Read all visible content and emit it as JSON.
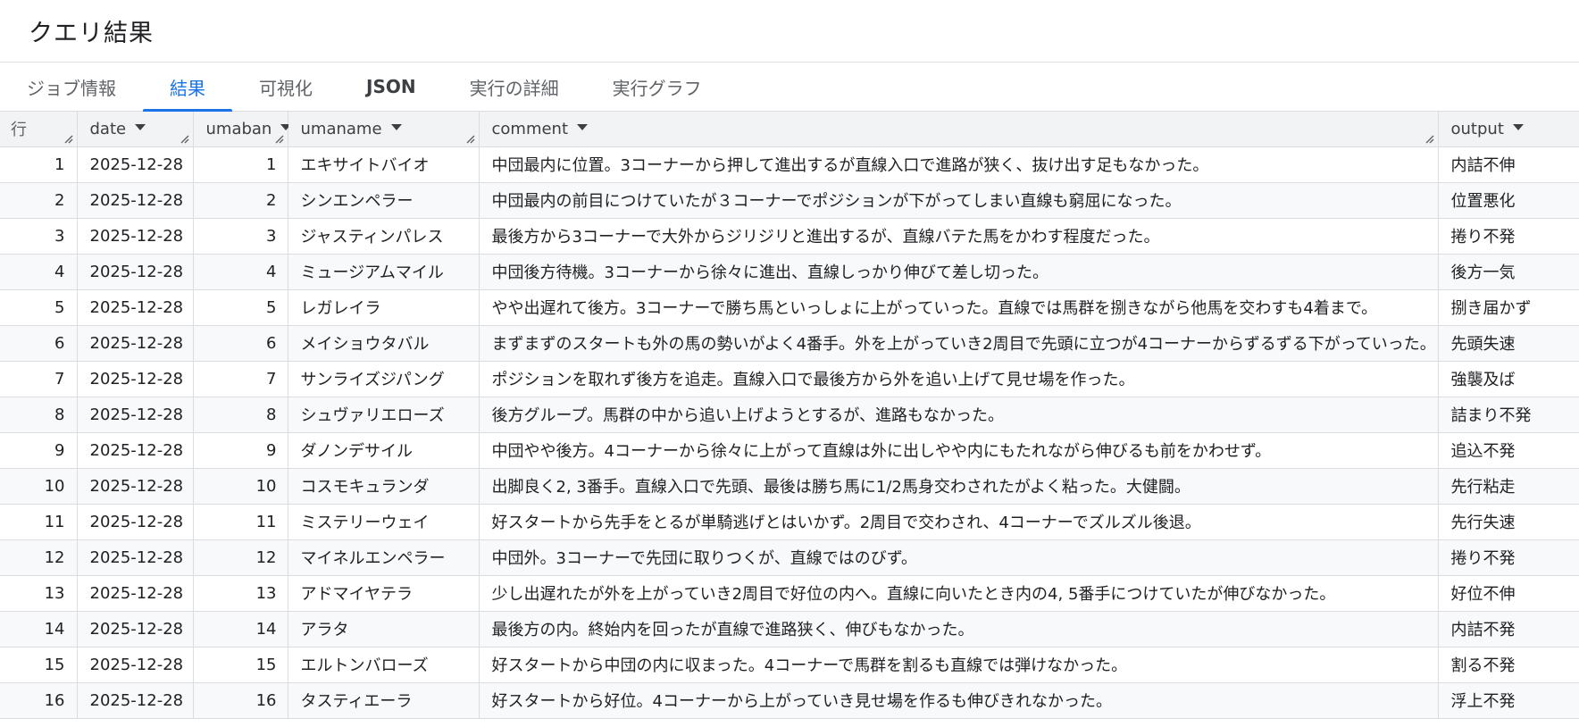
{
  "page_title": "クエリ結果",
  "tabs": [
    {
      "label": "ジョブ情報"
    },
    {
      "label": "結果"
    },
    {
      "label": "可視化"
    },
    {
      "label": "JSON"
    },
    {
      "label": "実行の詳細"
    },
    {
      "label": "実行グラフ"
    }
  ],
  "active_tab": "結果",
  "columns": {
    "row": "行",
    "date": "date",
    "umaban": "umaban",
    "umaname": "umaname",
    "comment": "comment",
    "output": "output"
  },
  "rows": [
    {
      "row": "1",
      "date": "2025-12-28",
      "umaban": "1",
      "umaname": "エキサイトバイオ",
      "comment": "中団最内に位置。3コーナーから押して進出するが直線入口で進路が狭く、抜け出す足もなかった。",
      "output": "内詰不伸"
    },
    {
      "row": "2",
      "date": "2025-12-28",
      "umaban": "2",
      "umaname": "シンエンペラー",
      "comment": "中団最内の前目につけていたが３コーナーでポジションが下がってしまい直線も窮屈になった。",
      "output": "位置悪化"
    },
    {
      "row": "3",
      "date": "2025-12-28",
      "umaban": "3",
      "umaname": "ジャスティンパレス",
      "comment": "最後方から3コーナーで大外からジリジリと進出するが、直線バテた馬をかわす程度だった。",
      "output": "捲り不発"
    },
    {
      "row": "4",
      "date": "2025-12-28",
      "umaban": "4",
      "umaname": "ミュージアムマイル",
      "comment": "中団後方待機。3コーナーから徐々に進出、直線しっかり伸びて差し切った。",
      "output": "後方一気"
    },
    {
      "row": "5",
      "date": "2025-12-28",
      "umaban": "5",
      "umaname": "レガレイラ",
      "comment": "やや出遅れて後方。3コーナーで勝ち馬といっしょに上がっていった。直線では馬群を捌きながら他馬を交わすも4着まで。",
      "output": "捌き届かず"
    },
    {
      "row": "6",
      "date": "2025-12-28",
      "umaban": "6",
      "umaname": "メイショウタバル",
      "comment": "まずまずのスタートも外の馬の勢いがよく4番手。外を上がっていき2周目で先頭に立つが4コーナーからずるずる下がっていった。",
      "output": "先頭失速"
    },
    {
      "row": "7",
      "date": "2025-12-28",
      "umaban": "7",
      "umaname": "サンライズジパング",
      "comment": "ポジションを取れず後方を追走。直線入口で最後方から外を追い上げて見せ場を作った。",
      "output": "強襲及ば"
    },
    {
      "row": "8",
      "date": "2025-12-28",
      "umaban": "8",
      "umaname": "シュヴァリエローズ",
      "comment": "後方グループ。馬群の中から追い上げようとするが、進路もなかった。",
      "output": "詰まり不発"
    },
    {
      "row": "9",
      "date": "2025-12-28",
      "umaban": "9",
      "umaname": "ダノンデサイル",
      "comment": "中団やや後方。4コーナーから徐々に上がって直線は外に出しやや内にもたれながら伸びるも前をかわせず。",
      "output": "追込不発"
    },
    {
      "row": "10",
      "date": "2025-12-28",
      "umaban": "10",
      "umaname": "コスモキュランダ",
      "comment": "出脚良く2, 3番手。直線入口で先頭、最後は勝ち馬に1/2馬身交わされたがよく粘った。大健闘。",
      "output": "先行粘走"
    },
    {
      "row": "11",
      "date": "2025-12-28",
      "umaban": "11",
      "umaname": "ミステリーウェイ",
      "comment": "好スタートから先手をとるが単騎逃げとはいかず。2周目で交わされ、4コーナーでズルズル後退。",
      "output": "先行失速"
    },
    {
      "row": "12",
      "date": "2025-12-28",
      "umaban": "12",
      "umaname": "マイネルエンペラー",
      "comment": "中団外。3コーナーで先団に取りつくが、直線ではのびず。",
      "output": "捲り不発"
    },
    {
      "row": "13",
      "date": "2025-12-28",
      "umaban": "13",
      "umaname": "アドマイヤテラ",
      "comment": "少し出遅れたが外を上がっていき2周目で好位の内へ。直線に向いたとき内の4, 5番手につけていたが伸びなかった。",
      "output": "好位不伸"
    },
    {
      "row": "14",
      "date": "2025-12-28",
      "umaban": "14",
      "umaname": "アラタ",
      "comment": "最後方の内。終始内を回ったが直線で進路狭く、伸びもなかった。",
      "output": "内詰不発"
    },
    {
      "row": "15",
      "date": "2025-12-28",
      "umaban": "15",
      "umaname": "エルトンバローズ",
      "comment": "好スタートから中団の内に収まった。4コーナーで馬群を割るも直線では弾けなかった。",
      "output": "割る不発"
    },
    {
      "row": "16",
      "date": "2025-12-28",
      "umaban": "16",
      "umaname": "タスティエーラ",
      "comment": "好スタートから好位。4コーナーから上がっていき見せ場を作るも伸びきれなかった。",
      "output": "浮上不発"
    }
  ],
  "icons": {
    "sort": "sort-caret-icon",
    "resize": "column-resize-icon"
  },
  "colors": {
    "accent": "#1a73e8",
    "header_bg": "#f1f3f4",
    "border": "#dadce0"
  }
}
